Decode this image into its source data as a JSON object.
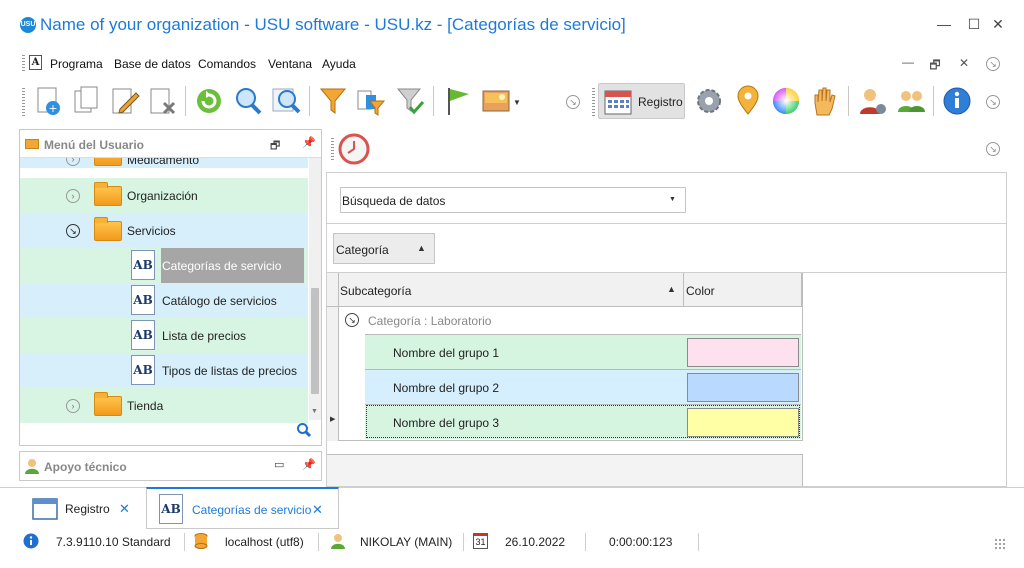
{
  "window": {
    "title": "Name of your organization - USU software - USU.kz - [Categorías de servicio]",
    "logo_text": "USU",
    "minimize": "—",
    "maximize": "☐",
    "close": "✕"
  },
  "menu": {
    "items": [
      "Programa",
      "Base de datos",
      "Comandos",
      "Ventana",
      "Ayuda"
    ],
    "mdi_restore": "🗗",
    "mdi_close": "✕",
    "more": "⊘"
  },
  "toolbar": {
    "registro_label": "Registro",
    "more_arrow": "⊘"
  },
  "left_panel": {
    "title": "Menú del Usuario",
    "partial_item": "Medicamento",
    "items": [
      {
        "label": "Organización"
      },
      {
        "label": "Servicios"
      },
      {
        "label": "Categorías de servicio"
      },
      {
        "label": "Catálogo de servicios"
      },
      {
        "label": "Lista de precios"
      },
      {
        "label": "Tipos de listas de precios"
      },
      {
        "label": "Tienda"
      }
    ],
    "icon_text": "AB"
  },
  "apoyo": {
    "title": "Apoyo técnico"
  },
  "main": {
    "search_placeholder": "Búsqueda de datos",
    "group_chip": "Categoría",
    "columns": {
      "subcategoria": "Subcategoría",
      "color": "Color"
    },
    "group_row": "Categoría : Laboratorio",
    "rows": [
      {
        "name": "Nombre del grupo 1",
        "color": "#fde1ef",
        "bg": "#d6f5e1"
      },
      {
        "name": "Nombre del grupo 2",
        "color": "#b9d9ff",
        "bg": "#d5efff"
      },
      {
        "name": "Nombre del grupo 3",
        "color": "#ffffa6",
        "bg": "#d6f5e1"
      }
    ]
  },
  "tabs": [
    {
      "label": "Registro"
    },
    {
      "label": "Categorías de servicio"
    }
  ],
  "tab_close": "✕",
  "status": {
    "version": "7.3.9110.10 Standard",
    "server": "localhost (utf8)",
    "user": "NIKOLAY (MAIN)",
    "calendar_day": "31",
    "date": "26.10.2022",
    "timer": "0:00:00:123"
  },
  "colors": {
    "accent": "#1e7ad8",
    "tree_green": "#d7f5e2",
    "tree_blue": "#d6effb",
    "selected": "#a6a6a6"
  }
}
